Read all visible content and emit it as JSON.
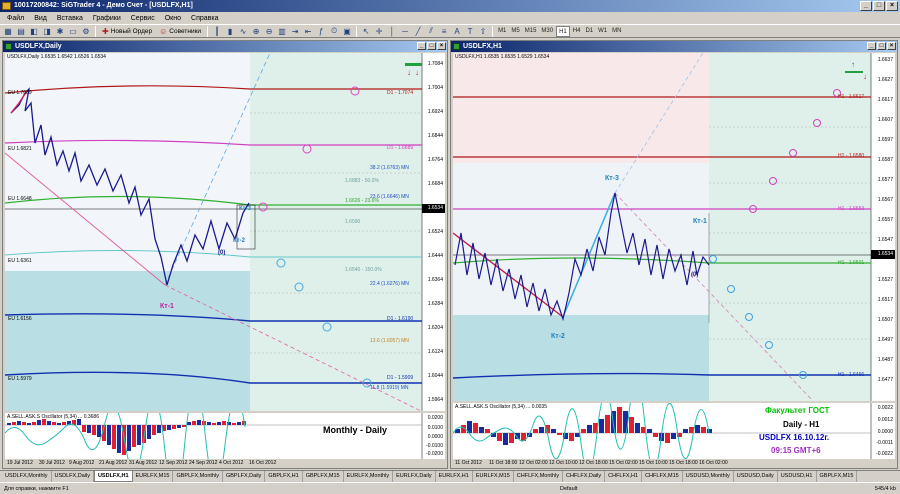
{
  "app": {
    "title": "10017200842: SiGTrader 4 - Демо Счет - [USDLFX,H1]",
    "window_controls": [
      "_",
      "□",
      "×"
    ]
  },
  "menu": [
    "Файл",
    "Вид",
    "Вставка",
    "Графики",
    "Сервис",
    "Окно",
    "Справка"
  ],
  "toolbar": {
    "new_order_label": "Новый Ордер",
    "experts_label": "Советники",
    "timeframes": [
      "M1",
      "M5",
      "M15",
      "M30",
      "H1",
      "H4",
      "D1",
      "W1",
      "MN"
    ],
    "active_timeframe": "H1"
  },
  "left_chart": {
    "title": "USDLFX,Daily",
    "info": "USDLFX,Daily  1.6535 1.6542 1.6526 1.6534",
    "prices": [
      "1.7084",
      "1.7044",
      "1.7004",
      "1.6964",
      "1.6924",
      "1.6884",
      "1.6844",
      "1.6804",
      "1.6764",
      "1.6724",
      "1.6684",
      "1.6644",
      "1.6604",
      "1.6564",
      "1.6524",
      "1.6484",
      "1.6444",
      "1.6404",
      "1.6364",
      "1.6324",
      "1.6284",
      "1.6244",
      "1.6204",
      "1.6164",
      "1.6124",
      "1.6084",
      "1.6044",
      "1.6004",
      "1.5964",
      "1.5924",
      "1.5884"
    ],
    "current_price": "1.6534",
    "level_labels": [
      "D1 - 1.7074",
      "D1 - 1.6889",
      "1.6883 - 50.0%",
      "38.2 (1.6763) MN",
      "23.6 (1.6646) MN",
      "1.6626 - 23.6%",
      "1.6590",
      "1.6540 - 150.0%",
      "22.4 (1.6276) MN",
      "D1 - 1.6190",
      "13.6 (1.6057) MN",
      "D1 - 1.5909",
      "11.8 (1.5919) MN"
    ],
    "left_labels": [
      "EU 1.7089",
      "EU 1.6821",
      "EU 1.6648",
      "EU 1.6361",
      "EU 1.6156",
      "EU 1.5979"
    ],
    "wave_labels": {
      "kt1": "Кт-1",
      "kt2": "Кт-2",
      "kt3": "Кт-3",
      "zero": "(0)"
    },
    "dates": [
      "19 Jul 2012",
      "30 Jul 2012",
      "9 Aug 2012",
      "21 Aug 2012",
      "31 Aug 2012",
      "12 Sep 2012",
      "24 Sep 2012",
      "4 Oct 2012",
      "16 Oct 2012"
    ],
    "osc_info": "A.SELL.ASK.S Oscillator (5,34) ... 0.3686",
    "osc_prices": [
      "0.0200",
      "0.0100",
      "0.0000",
      "-0.0100",
      "-0.0200"
    ],
    "caption": "Monthly - Daily"
  },
  "right_chart": {
    "title": "USDLFX,H1",
    "info": "USDLFX,H1  1.6535 1.6535 1.6529 1.6534",
    "prices": [
      "1.6637",
      "1.6627",
      "1.6617",
      "1.6607",
      "1.6597",
      "1.6587",
      "1.6577",
      "1.6567",
      "1.6557",
      "1.6547",
      "1.6537",
      "1.6527",
      "1.6517",
      "1.6507",
      "1.6497",
      "1.6487",
      "1.6477",
      "1.6467",
      "1.6457"
    ],
    "current_price": "1.6534",
    "level_labels": [
      "H1 - 1.6617",
      "H1 - 1.6580",
      "H1 - 1.6553",
      "H1 - 1.6501",
      "H1 - 1.6466"
    ],
    "wave_labels": {
      "kt1": "Кт-1",
      "kt2": "Кт-2",
      "kt3": "Кт-3",
      "zero": "(0)"
    },
    "dates": [
      "11 Oct 2012",
      "11 Oct 18:00",
      "12 Oct 02:00",
      "12 Oct 10:00",
      "12 Oct 18:00",
      "15 Oct 02:00",
      "15 Oct 10:00",
      "15 Oct 18:00",
      "16 Oct 02:00"
    ],
    "osc_info": "A.SELL.ASK.S Oscillator (5,34) ... 0.0035",
    "osc_prices": [
      "0.0022",
      "0.0012",
      "0.0000",
      "-0.0011",
      "-0.0022"
    ]
  },
  "captions": {
    "faculty": "Факультет ГОСТ",
    "daily_h1": "Daily - H1",
    "date": "USDLFX 16.10.12г.",
    "time": "09:15  GMT+6"
  },
  "colors": {
    "window_title": "#0a246a",
    "caption_green": "#00c000",
    "caption_blue": "#0000c0",
    "caption_purple": "#a030c0",
    "wave": "#1a1a8c",
    "trend": "#d02060"
  },
  "tabs": [
    "USDLFX,Monthly",
    "USDLFX,Daily",
    "USDLFX,H1",
    "EURLFX,M15",
    "GBPLFX,Monthly",
    "GBPLFX,Daily",
    "GBPLFX,H1",
    "GBPLFX,M15",
    "EURLFX,Monthly",
    "EURLFX,Daily",
    "EURLFX,H1",
    "EURLFX,M15",
    "CHFLFX,Monthly",
    "CHFLFX,Daily",
    "CHFLFX,H1",
    "CHFLFX,M15",
    "USDUSD,Monthly",
    "USDUSD,Daily",
    "USDUSD,H1",
    "GBPLFX,M15"
  ],
  "active_tab": "USDLFX,H1",
  "status": {
    "left": "Для справки, нажмите F1",
    "middle": "Default",
    "right": "545/4 kb"
  }
}
